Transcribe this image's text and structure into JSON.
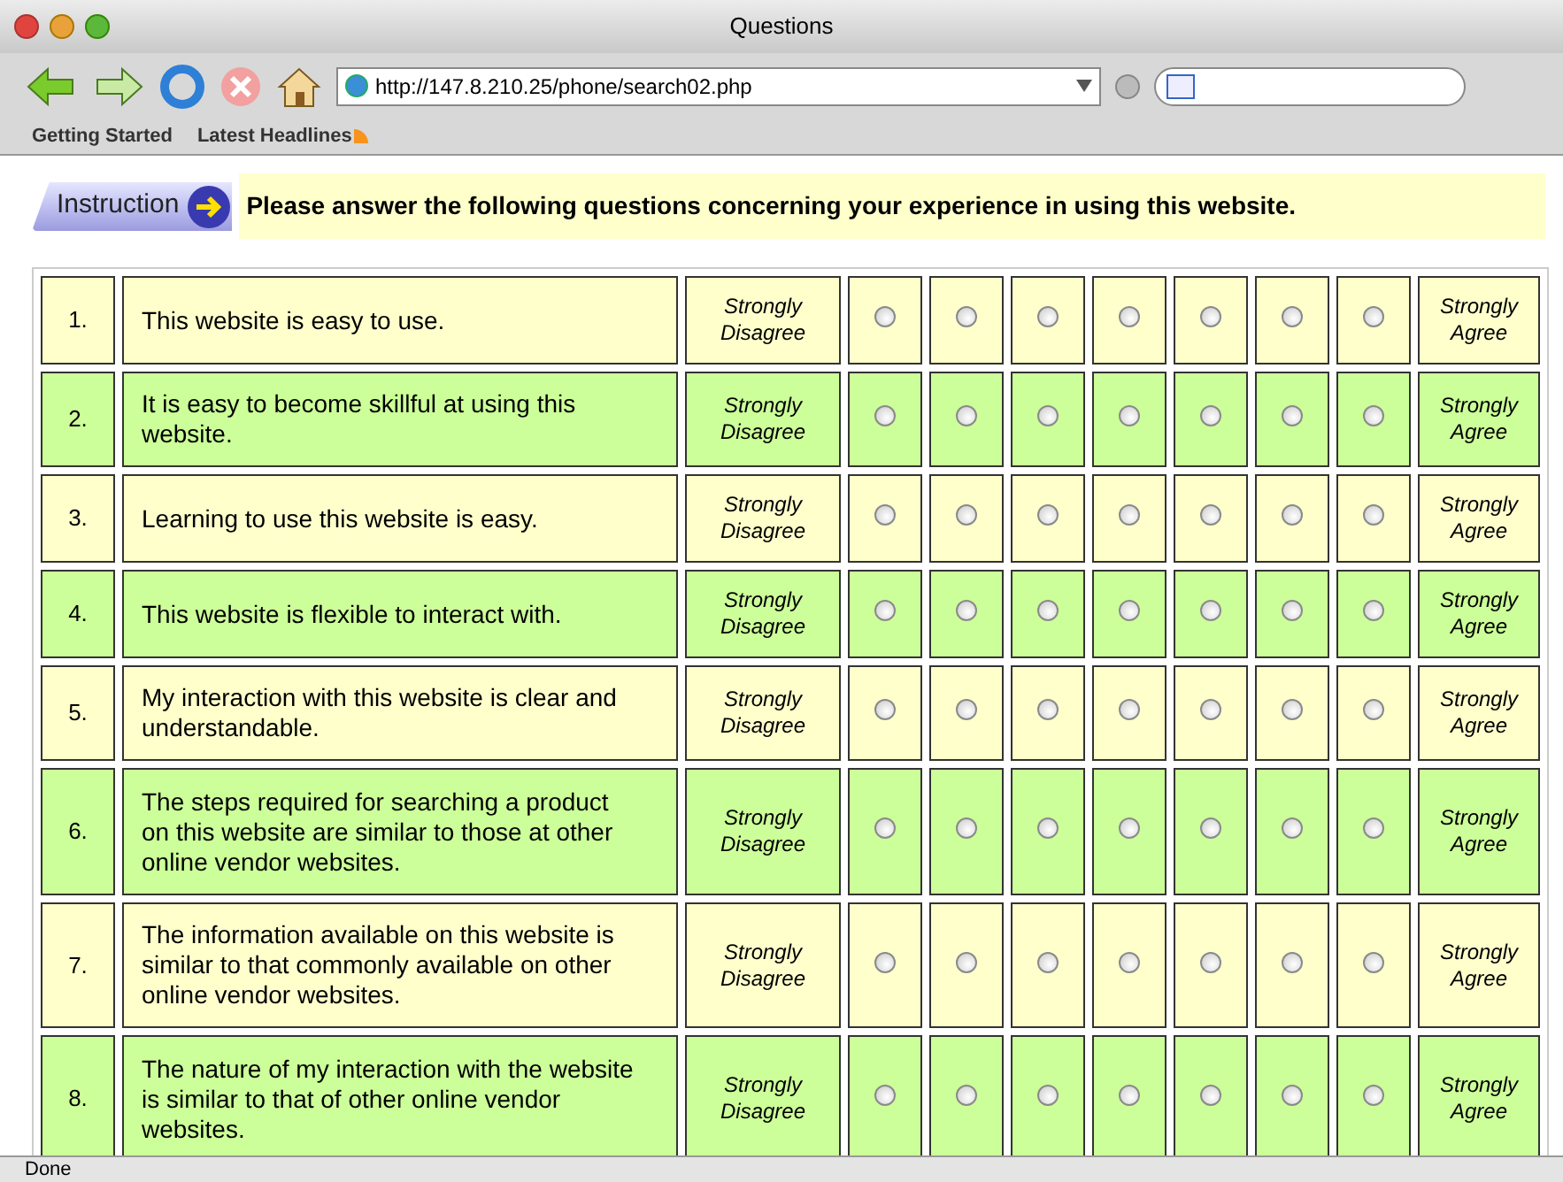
{
  "window": {
    "title": "Questions"
  },
  "address_bar": {
    "url": "http://147.8.210.25/phone/search02.php"
  },
  "bookmarks": [
    {
      "label": "Getting Started",
      "kind": "plain"
    },
    {
      "label": "Latest Headlines",
      "kind": "feed"
    }
  ],
  "instruction": {
    "badge": "Instruction",
    "text": "Please answer the following questions concerning your experience in using this website."
  },
  "rows": [
    {
      "number": "1.",
      "question": "This website is easy to use.",
      "low_label": "Strongly Disagree",
      "high_label": "Strongly Agree",
      "color": "#ffffcc",
      "options": [
        {
          "selected": false
        },
        {
          "selected": false
        },
        {
          "selected": false
        },
        {
          "selected": false
        },
        {
          "selected": false
        },
        {
          "selected": false
        },
        {
          "selected": false
        }
      ]
    },
    {
      "number": "2.",
      "question": "It is easy to become skillful at using this website.",
      "low_label": "Strongly Disagree",
      "high_label": "Strongly Agree",
      "color": "#ccff99",
      "options": [
        {
          "selected": false
        },
        {
          "selected": false
        },
        {
          "selected": false
        },
        {
          "selected": false
        },
        {
          "selected": false
        },
        {
          "selected": false
        },
        {
          "selected": false
        }
      ]
    },
    {
      "number": "3.",
      "question": "Learning to use this website is easy.",
      "low_label": "Strongly Disagree",
      "high_label": "Strongly Agree",
      "color": "#ffffcc",
      "options": [
        {
          "selected": false
        },
        {
          "selected": false
        },
        {
          "selected": false
        },
        {
          "selected": false
        },
        {
          "selected": false
        },
        {
          "selected": false
        },
        {
          "selected": false
        }
      ]
    },
    {
      "number": "4.",
      "question": "This website is flexible to interact with.",
      "low_label": "Strongly Disagree",
      "high_label": "Strongly Agree",
      "color": "#ccff99",
      "options": [
        {
          "selected": false
        },
        {
          "selected": false
        },
        {
          "selected": false
        },
        {
          "selected": false
        },
        {
          "selected": false
        },
        {
          "selected": false
        },
        {
          "selected": false
        }
      ]
    },
    {
      "number": "5.",
      "question": "My interaction with this website is clear and understandable.",
      "low_label": "Strongly Disagree",
      "high_label": "Strongly Agree",
      "color": "#ffffcc",
      "options": [
        {
          "selected": false
        },
        {
          "selected": false
        },
        {
          "selected": false
        },
        {
          "selected": false
        },
        {
          "selected": false
        },
        {
          "selected": false
        },
        {
          "selected": false
        }
      ]
    },
    {
      "number": "6.",
      "question": "The steps required for searching a product on this website are similar to those at other online vendor websites.",
      "low_label": "Strongly Disagree",
      "high_label": "Strongly Agree",
      "color": "#ccff99",
      "options": [
        {
          "selected": false
        },
        {
          "selected": false
        },
        {
          "selected": false
        },
        {
          "selected": false
        },
        {
          "selected": false
        },
        {
          "selected": false
        },
        {
          "selected": false
        }
      ]
    },
    {
      "number": "7.",
      "question": "The information available on this website is similar to that commonly available on other online vendor websites.",
      "low_label": "Strongly Disagree",
      "high_label": "Strongly Agree",
      "color": "#ffffcc",
      "options": [
        {
          "selected": false
        },
        {
          "selected": false
        },
        {
          "selected": false
        },
        {
          "selected": false
        },
        {
          "selected": false
        },
        {
          "selected": false
        },
        {
          "selected": false
        }
      ]
    },
    {
      "number": "8.",
      "question": "The nature of my interaction with the website is similar to that of other online vendor websites.",
      "low_label": "Strongly Disagree",
      "high_label": "Strongly Agree",
      "color": "#ccff99",
      "options": [
        {
          "selected": false
        },
        {
          "selected": false
        },
        {
          "selected": false
        },
        {
          "selected": false
        },
        {
          "selected": false
        },
        {
          "selected": false
        },
        {
          "selected": false
        }
      ]
    }
  ],
  "status_bar": {
    "text": "Done"
  }
}
